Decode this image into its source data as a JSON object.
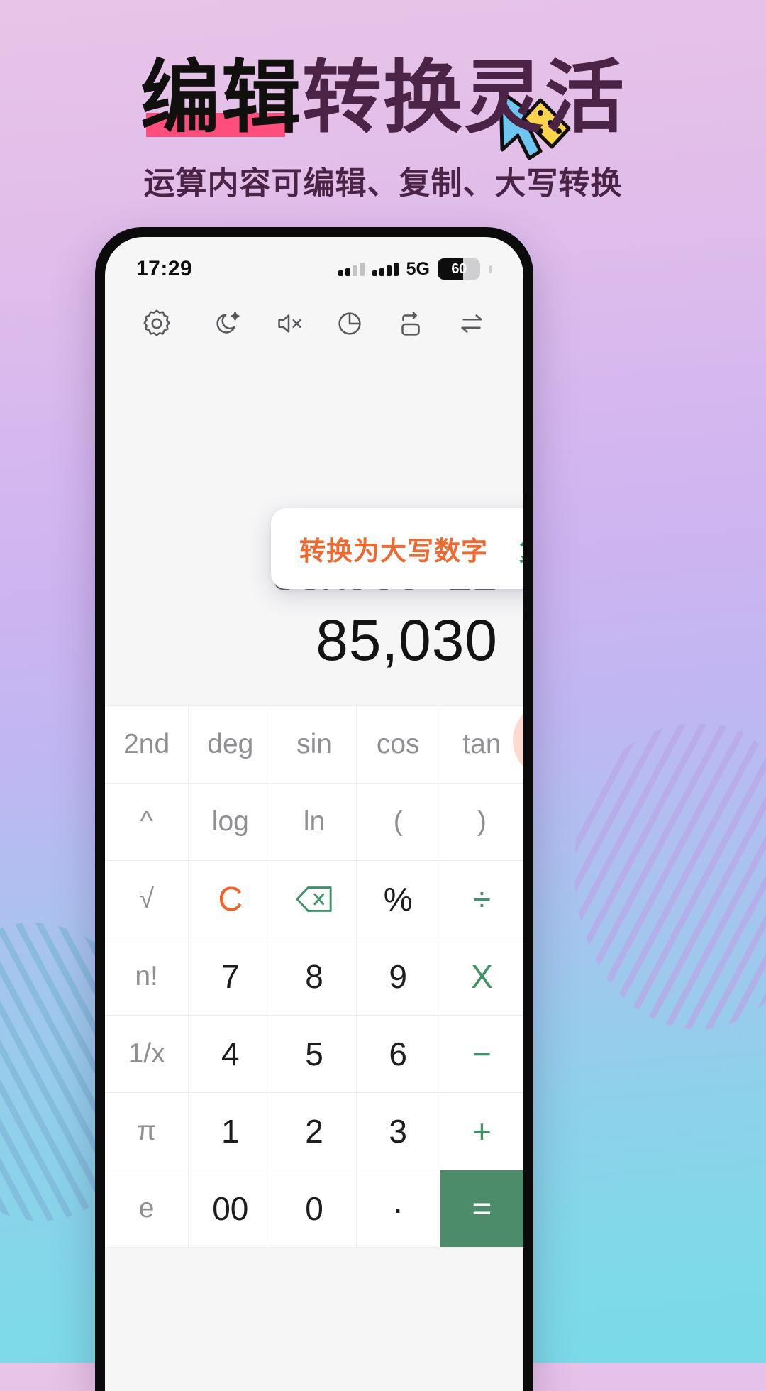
{
  "poster": {
    "headline_black": "编辑",
    "headline_purple": "转换灵活",
    "subtitle": "运算内容可编辑、复制、大写转换",
    "highlight_color": "#ff4d7e",
    "headline_black_color": "#12100f",
    "headline_purple_color": "#4b2347"
  },
  "phone": {
    "statusbar": {
      "time": "17:29",
      "network": "5G",
      "battery_level": "60"
    },
    "toolbar": {
      "settings": "gear-icon",
      "dark_mode": "moon-star-icon",
      "sound_off": "speaker-mute-icon",
      "history": "clock-icon",
      "rotate": "screen-rotate-icon",
      "convert": "swap-arrows-icon"
    },
    "popup": {
      "convert_upper_label": "转换为大写数字",
      "copy_label": "复制",
      "convert_color": "#ee6a33",
      "copy_color": "#3e9467"
    },
    "display": {
      "expression": "88x966+22",
      "result": "85,030"
    },
    "keypad": {
      "rows": [
        [
          {
            "label": "2nd",
            "style": "fn"
          },
          {
            "label": "deg",
            "style": "fn"
          },
          {
            "label": "sin",
            "style": "fn"
          },
          {
            "label": "cos",
            "style": "fn"
          },
          {
            "label": "tan",
            "style": "fn"
          }
        ],
        [
          {
            "label": "^",
            "style": "fn"
          },
          {
            "label": "log",
            "style": "fn"
          },
          {
            "label": "ln",
            "style": "fn"
          },
          {
            "label": "(",
            "style": "fn"
          },
          {
            "label": ")",
            "style": "fn"
          }
        ],
        [
          {
            "label": "√",
            "style": "fn"
          },
          {
            "label": "C",
            "style": "orange"
          },
          {
            "label": "backspace-icon",
            "style": "green-icon"
          },
          {
            "label": "%",
            "style": "num"
          },
          {
            "label": "÷",
            "style": "green"
          }
        ],
        [
          {
            "label": "n!",
            "style": "fn"
          },
          {
            "label": "7",
            "style": "num"
          },
          {
            "label": "8",
            "style": "num"
          },
          {
            "label": "9",
            "style": "num"
          },
          {
            "label": "X",
            "style": "green"
          }
        ],
        [
          {
            "label": "1/x",
            "style": "fn"
          },
          {
            "label": "4",
            "style": "num"
          },
          {
            "label": "5",
            "style": "num"
          },
          {
            "label": "6",
            "style": "num"
          },
          {
            "label": "−",
            "style": "green"
          }
        ],
        [
          {
            "label": "π",
            "style": "fn"
          },
          {
            "label": "1",
            "style": "num"
          },
          {
            "label": "2",
            "style": "num"
          },
          {
            "label": "3",
            "style": "num"
          },
          {
            "label": "+",
            "style": "green"
          }
        ],
        [
          {
            "label": "e",
            "style": "fn"
          },
          {
            "label": "00",
            "style": "num"
          },
          {
            "label": "0",
            "style": "num"
          },
          {
            "label": "·",
            "style": "num"
          },
          {
            "label": "=",
            "style": "eq"
          }
        ]
      ]
    }
  }
}
